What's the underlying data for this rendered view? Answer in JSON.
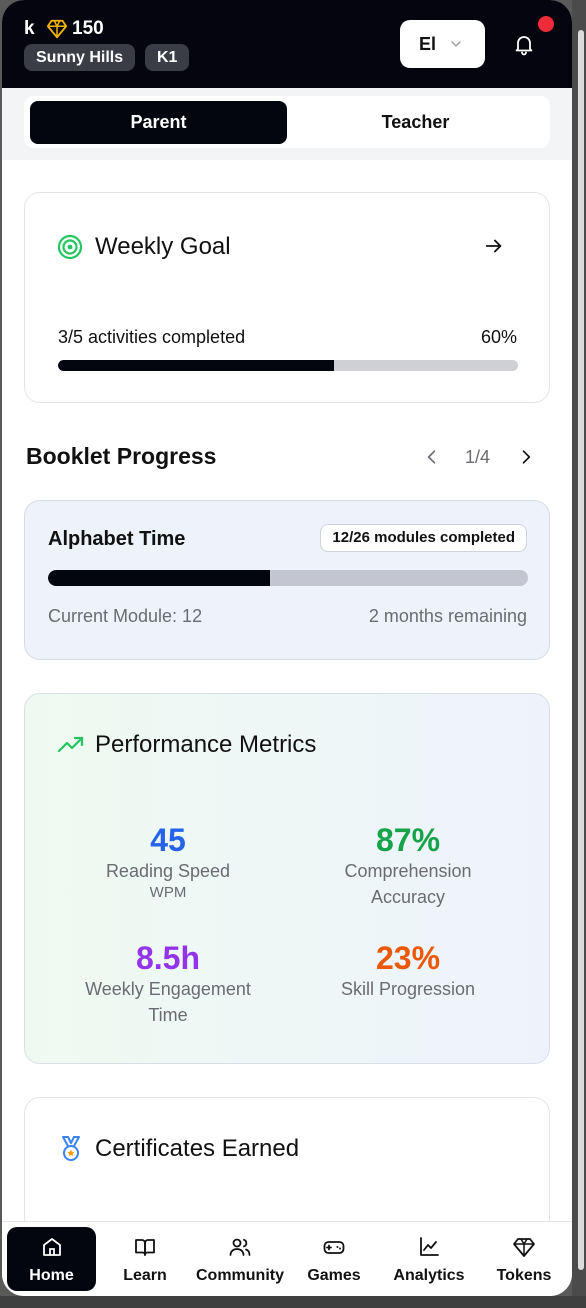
{
  "header": {
    "user_initial": "k",
    "tokens": "150",
    "school": "Sunny Hills",
    "grade": "K1",
    "language": "El",
    "notification_dot": true
  },
  "role_toggle": {
    "options": [
      "Parent",
      "Teacher"
    ],
    "selected": "Parent"
  },
  "weekly_goal": {
    "title": "Weekly Goal",
    "progress_text": "3/5 activities completed",
    "percent_text": "60%",
    "progress_fraction": 0.6
  },
  "booklet": {
    "section_title": "Booklet Progress",
    "page_indicator": "1/4",
    "name": "Alphabet Time",
    "modules_badge": "12/26 modules completed",
    "progress_fraction": 0.4615,
    "current_module": "Current Module: 12",
    "remaining": "2 months remaining"
  },
  "performance": {
    "title": "Performance Metrics",
    "metrics": [
      {
        "value": "45",
        "label": "Reading Speed",
        "sub": "WPM",
        "color": "#2563eb"
      },
      {
        "value": "87%",
        "label": "Comprehension Accuracy",
        "sub": "",
        "color": "#16a34a"
      },
      {
        "value": "8.5h",
        "label": "Weekly Engagement Time",
        "sub": "",
        "color": "#9333ea"
      },
      {
        "value": "23%",
        "label": "Skill Progression",
        "sub": "",
        "color": "#ea580c"
      }
    ]
  },
  "certificates": {
    "title": "Certificates Earned"
  },
  "bottom_nav": {
    "items": [
      {
        "label": "Home",
        "icon": "home-icon",
        "active": true
      },
      {
        "label": "Learn",
        "icon": "book-icon",
        "active": false
      },
      {
        "label": "Community",
        "icon": "users-icon",
        "active": false
      },
      {
        "label": "Games",
        "icon": "gamepad-icon",
        "active": false
      },
      {
        "label": "Analytics",
        "icon": "chart-icon",
        "active": false
      },
      {
        "label": "Tokens",
        "icon": "gem-icon",
        "active": false
      }
    ]
  },
  "colors": {
    "header_bg": "#04050f",
    "accent_green": "#16a34a",
    "accent_blue": "#2563eb",
    "notification": "#ef2b3a",
    "gem": "#f5b301"
  }
}
